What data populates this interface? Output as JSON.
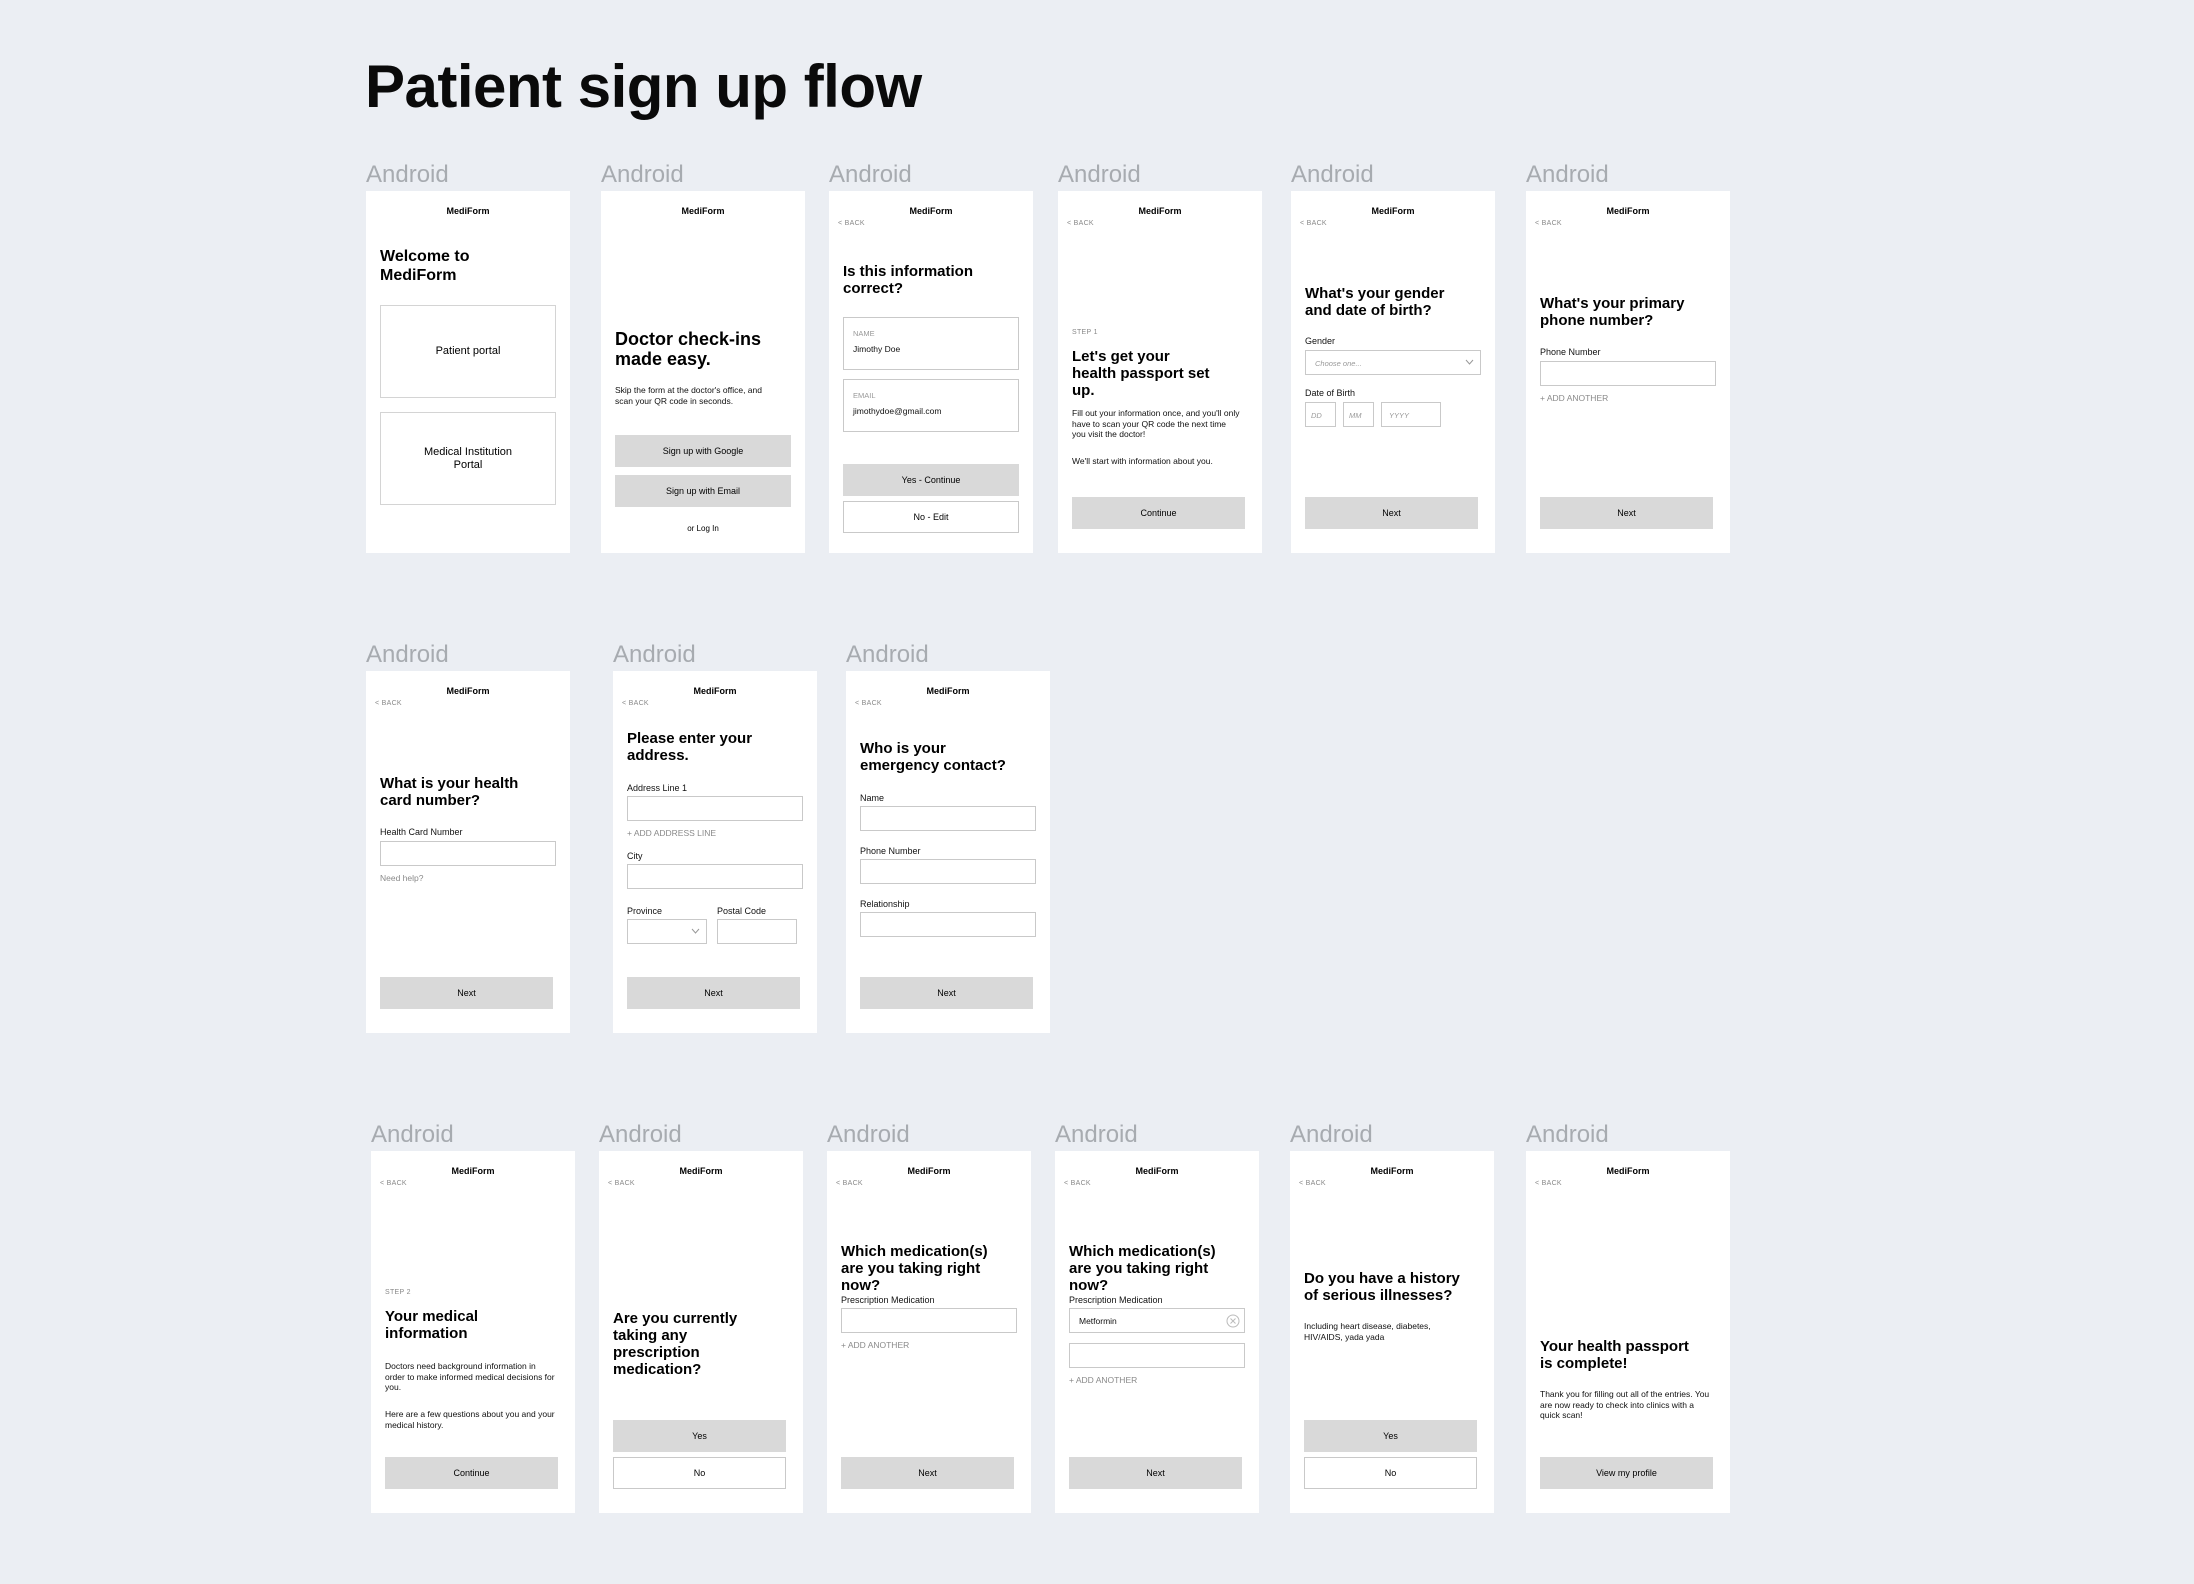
{
  "title": "Patient sign up flow",
  "frame_label": "Android",
  "brand": "MediForm",
  "back": "< BACK",
  "welcome": {
    "heading": "Welcome to MediForm",
    "patient": "Patient portal",
    "institution": "Medical Institution Portal"
  },
  "checkin": {
    "heading": "Doctor check-ins made easy.",
    "body": "Skip the form at the doctor's office, and scan your QR code in seconds.",
    "google": "Sign up with Google",
    "email": "Sign up with Email",
    "login": "or Log In"
  },
  "confirm": {
    "heading": "Is this information correct?",
    "name_label": "NAME",
    "name_value": "Jimothy Doe",
    "email_label": "EMAIL",
    "email_value": "jimothydoe@gmail.com",
    "yes": "Yes - Continue",
    "no": "No - Edit"
  },
  "step1": {
    "step": "STEP 1",
    "heading": "Let's get your health passport set up.",
    "body1": "Fill out your information once, and you'll only have to scan your QR code the next time you visit the doctor!",
    "body2": "We'll start with information about you.",
    "cta": "Continue"
  },
  "gender": {
    "heading": "What's your gender and date of birth?",
    "gender_label": "Gender",
    "gender_placeholder": "Choose one...",
    "dob_label": "Date of Birth",
    "dd": "DD",
    "mm": "MM",
    "yyyy": "YYYY",
    "cta": "Next"
  },
  "phone": {
    "heading": "What's your primary phone number?",
    "label": "Phone Number",
    "add": "+ ADD ANOTHER",
    "cta": "Next"
  },
  "health": {
    "heading": "What is your health card number?",
    "label": "Health Card Number",
    "help": "Need help?",
    "cta": "Next"
  },
  "address": {
    "heading": "Please enter your address.",
    "line1": "Address Line 1",
    "add": "+ ADD ADDRESS LINE",
    "city": "City",
    "province": "Province",
    "postal": "Postal Code",
    "cta": "Next"
  },
  "emergency": {
    "heading": "Who is your emergency contact?",
    "name": "Name",
    "phone": "Phone Number",
    "relationship": "Relationship",
    "cta": "Next"
  },
  "step2": {
    "step": "STEP 2",
    "heading": "Your medical information",
    "body1": "Doctors need background information in order to make informed medical decisions for you.",
    "body2": "Here are a few questions about you and your medical history.",
    "cta": "Continue"
  },
  "prescription": {
    "heading": "Are you currently taking any prescription medication?",
    "yes": "Yes",
    "no": "No"
  },
  "meds_empty": {
    "heading": "Which medication(s) are you taking right now?",
    "label": "Prescription Medication",
    "add": "+ ADD ANOTHER",
    "cta": "Next"
  },
  "meds_filled": {
    "heading": "Which medication(s) are you taking right now?",
    "label": "Prescription Medication",
    "value": "Metformin",
    "add": "+ ADD ANOTHER",
    "cta": "Next"
  },
  "illness": {
    "heading": "Do you have a history of serious illnesses?",
    "body": "Including heart disease, diabetes, HIV/AIDS, yada yada",
    "yes": "Yes",
    "no": "No"
  },
  "complete": {
    "heading": "Your health passport is complete!",
    "body": "Thank you for filling out all of the entries. You are now ready to check into clinics with a quick scan!",
    "cta": "View my profile"
  }
}
